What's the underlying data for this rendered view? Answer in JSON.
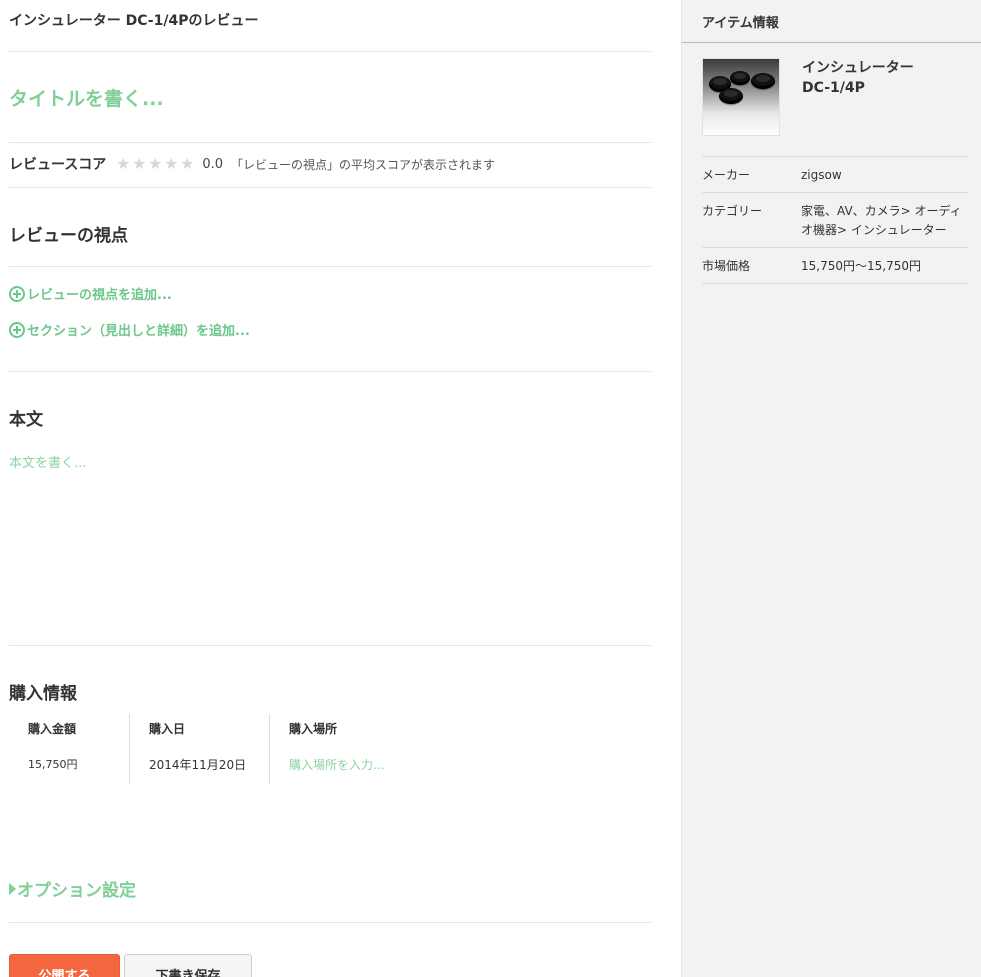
{
  "header": {
    "title": "インシュレーター DC-1/4Pのレビュー"
  },
  "title_input": {
    "placeholder": "タイトルを書く..."
  },
  "score": {
    "label": "レビュースコア",
    "rating": 0,
    "max": 5,
    "value_text": "0.0",
    "note": "「レビューの視点」の平均スコアが表示されます"
  },
  "viewpoints": {
    "heading": "レビューの視点",
    "add_viewpoint": "レビューの視点を追加...",
    "add_section": "セクション（見出しと詳細）を追加..."
  },
  "body_section": {
    "heading": "本文",
    "placeholder": "本文を書く..."
  },
  "purchase": {
    "heading": "購入情報",
    "columns": [
      {
        "label": "購入金額",
        "value": "15,750円"
      },
      {
        "label": "購入日",
        "value": "2014年11月20日"
      },
      {
        "label": "購入場所",
        "placeholder": "購入場所を入力..."
      }
    ]
  },
  "options": {
    "label": "オプション設定"
  },
  "buttons": {
    "publish": "公開する",
    "draft": "下書き保存"
  },
  "sidebar": {
    "title": "アイテム情報",
    "product_name_line1": "インシュレーター",
    "product_name_line2": "DC-1/4P",
    "rows": [
      {
        "key": "メーカー",
        "value": "zigsow"
      },
      {
        "key": "カテゴリー",
        "value": "家電、AV、カメラ> オーディオ機器> インシュレーター"
      },
      {
        "key": "市場価格",
        "value": "15,750円〜15,750円"
      }
    ]
  },
  "colors": {
    "accent_green": "#7fcf97",
    "publish_orange": "#f4663f",
    "star_empty": "#d7d7de",
    "sidebar_bg": "#f2f2f2"
  },
  "icons": [
    "plus-circle-icon",
    "triangle-right-icon",
    "star-icon"
  ]
}
